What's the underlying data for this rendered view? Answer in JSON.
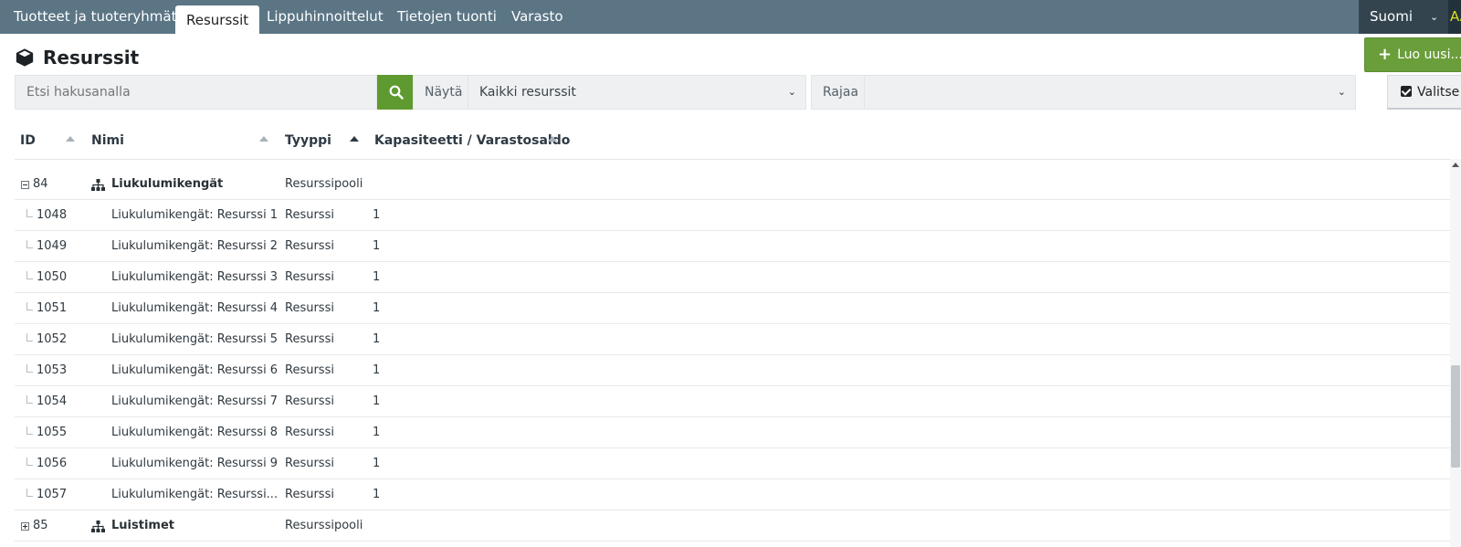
{
  "nav": {
    "tabs": [
      {
        "label": "Tuotteet ja tuoteryhmät"
      },
      {
        "label": "Resurssit"
      },
      {
        "label": "Lippuhinnoittelut"
      },
      {
        "label": "Tietojen tuonti"
      },
      {
        "label": "Varasto"
      }
    ],
    "active_tab": "Resurssit",
    "language": "Suomi",
    "user_initials": "AA"
  },
  "page": {
    "title": "Resurssit",
    "new_button": "Luo uusi..."
  },
  "filters": {
    "search_placeholder": "Etsi hakusanalla",
    "show_label": "Näytä",
    "show_value": "Kaikki resurssit",
    "limit_label": "Rajaa",
    "limit_value": "",
    "select_button": "Valitse"
  },
  "table": {
    "headers": {
      "id": "ID",
      "name": "Nimi",
      "type": "Tyyppi",
      "capacity": "Kapasiteetti / Varastosaldo"
    },
    "sorted_by": "Tyyppi",
    "rows": [
      {
        "id": "84",
        "name": "Liukulumikengät",
        "type": "Resurssipooli",
        "capacity": "",
        "kind": "pool",
        "expanded": true
      },
      {
        "id": "1048",
        "name": "Liukulumikengät: Resurssi 1",
        "type": "Resurssi",
        "capacity": "1",
        "kind": "child"
      },
      {
        "id": "1049",
        "name": "Liukulumikengät: Resurssi 2",
        "type": "Resurssi",
        "capacity": "1",
        "kind": "child"
      },
      {
        "id": "1050",
        "name": "Liukulumikengät: Resurssi 3",
        "type": "Resurssi",
        "capacity": "1",
        "kind": "child"
      },
      {
        "id": "1051",
        "name": "Liukulumikengät: Resurssi 4",
        "type": "Resurssi",
        "capacity": "1",
        "kind": "child"
      },
      {
        "id": "1052",
        "name": "Liukulumikengät: Resurssi 5",
        "type": "Resurssi",
        "capacity": "1",
        "kind": "child"
      },
      {
        "id": "1053",
        "name": "Liukulumikengät: Resurssi 6",
        "type": "Resurssi",
        "capacity": "1",
        "kind": "child"
      },
      {
        "id": "1054",
        "name": "Liukulumikengät: Resurssi 7",
        "type": "Resurssi",
        "capacity": "1",
        "kind": "child"
      },
      {
        "id": "1055",
        "name": "Liukulumikengät: Resurssi 8",
        "type": "Resurssi",
        "capacity": "1",
        "kind": "child"
      },
      {
        "id": "1056",
        "name": "Liukulumikengät: Resurssi 9",
        "type": "Resurssi",
        "capacity": "1",
        "kind": "child"
      },
      {
        "id": "1057",
        "name": "Liukulumikengät: Resurssi...",
        "type": "Resurssi",
        "capacity": "1",
        "kind": "child"
      },
      {
        "id": "85",
        "name": "Luistimet",
        "type": "Resurssipooli",
        "capacity": "",
        "kind": "pool",
        "expanded": false
      }
    ]
  },
  "colors": {
    "nav_bg": "#5b7585",
    "accent_green": "#5f9a30",
    "language_bg": "#33444f"
  }
}
